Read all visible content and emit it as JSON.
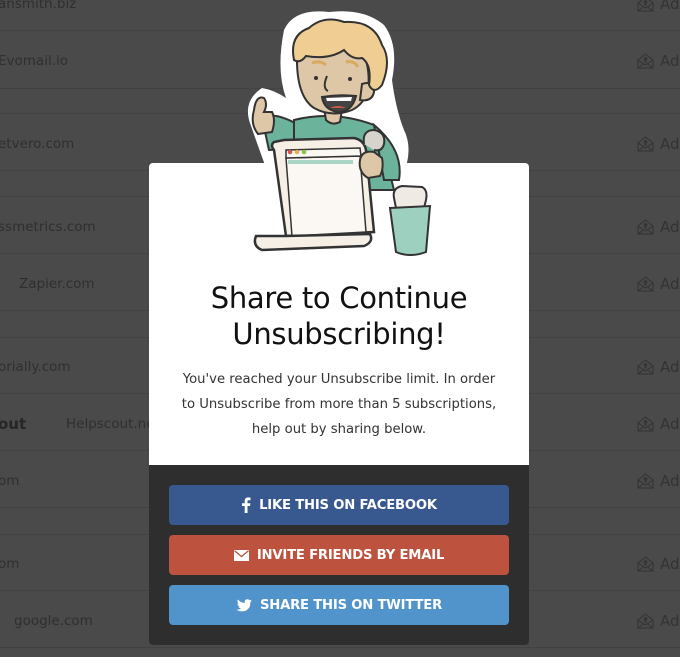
{
  "background_list": {
    "rows": [
      {
        "text": "ansmith.biz",
        "bold_prefix": "",
        "text_offset": "none",
        "action": "Ad"
      },
      {
        "text": "Evomail.io",
        "bold_prefix": "",
        "text_offset": "none",
        "action": "Ad"
      },
      {
        "text": "etvero.com",
        "bold_prefix": "",
        "text_offset": "none",
        "action": "Ad"
      },
      {
        "text": "ssmetrics.com",
        "bold_prefix": "",
        "text_offset": "none",
        "action": "Ad"
      },
      {
        "text": "Zapier.com",
        "bold_prefix": "",
        "text_offset": "indent",
        "action": "Ad"
      },
      {
        "text": "orially.com",
        "bold_prefix": "",
        "text_offset": "none",
        "action": "Ad"
      },
      {
        "text": "Helpscout.ne",
        "bold_prefix": "out",
        "text_offset": "after-bold",
        "action": "Ad"
      },
      {
        "text": "om",
        "bold_prefix": "",
        "text_offset": "none",
        "action": "Ad"
      },
      {
        "text": "om",
        "bold_prefix": "",
        "text_offset": "none",
        "action": "Ad"
      },
      {
        "text": "google.com",
        "bold_prefix": "",
        "text_offset": "indent",
        "action": "Ad"
      }
    ],
    "action_icon": "envelope-upload-icon"
  },
  "modal": {
    "illustration": "person-holding-unsubscribe-scroll-illustration",
    "title_line1": "Share to Continue",
    "title_line2": "Unsubscribing!",
    "description_line1": "You've reached your Unsubscribe limit. In order",
    "description_line2": "to Unsubscribe from more than 5 subscriptions,",
    "description_line3": "help out by sharing below.",
    "buttons": [
      {
        "label": "LIKE THIS ON FACEBOOK",
        "icon": "facebook-icon",
        "color": "#38598f"
      },
      {
        "label": "INVITE FRIENDS BY EMAIL",
        "icon": "envelope-icon",
        "color": "#bd533f"
      },
      {
        "label": "SHARE THIS ON TWITTER",
        "icon": "twitter-icon",
        "color": "#5193cb"
      }
    ]
  },
  "colors": {
    "overlay_background": "#4a4a4a",
    "modal_top": "#ffffff",
    "modal_bottom": "#2e2e2e"
  }
}
